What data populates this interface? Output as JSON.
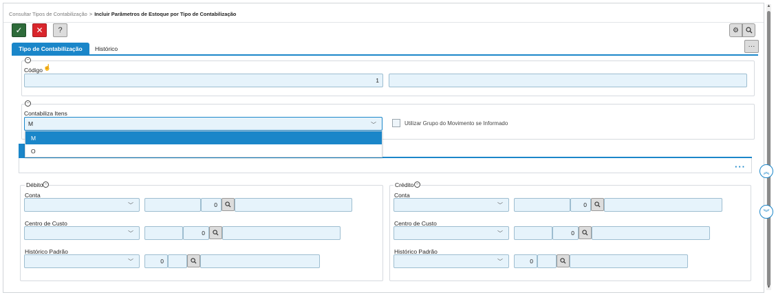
{
  "breadcrumb": {
    "parent": "Consultar Tipos de Contabilização",
    "separator": ">",
    "current": "Incluir Parâmetros de Estoque por Tipo de Contabilização"
  },
  "toolbar": {
    "confirm_icon": "check-icon",
    "cancel_icon": "close-icon",
    "help_label": "?",
    "settings_icon": "gear-icon",
    "search_icon": "search-icon",
    "more_label": "···"
  },
  "tabs": [
    {
      "label": "Tipo de Contabilização",
      "active": true
    },
    {
      "label": "Histórico",
      "active": false
    }
  ],
  "codigo": {
    "label": "Código",
    "value": "1",
    "description": ""
  },
  "contabiliza": {
    "label": "Contabiliza Itens",
    "selected": "M",
    "options": [
      "M",
      "O"
    ],
    "checkbox_label": "Utilizar Grupo do Movimento se Informado"
  },
  "debito": {
    "title": "Débito",
    "conta_label": "Conta",
    "conta_code": "",
    "conta_value": "0",
    "conta_desc": "",
    "centro_label": "Centro de Custo",
    "centro_code": "",
    "centro_value": "0",
    "centro_desc": "",
    "historico_label": "Histórico Padrão",
    "historico_value": "0",
    "historico_code": "",
    "historico_desc": ""
  },
  "credito": {
    "title": "Crédito",
    "conta_label": "Conta",
    "conta_code": "",
    "conta_value": "0",
    "conta_desc": "",
    "centro_label": "Centro de Custo",
    "centro_code": "",
    "centro_value": "0",
    "centro_desc": "",
    "historico_label": "Histórico Padrão",
    "historico_value": "0",
    "historico_code": "",
    "historico_desc": ""
  },
  "colors": {
    "accent": "#1a86c9",
    "confirm": "#2e6b3a",
    "cancel": "#d9262c",
    "input_bg": "#e6f3fb"
  }
}
